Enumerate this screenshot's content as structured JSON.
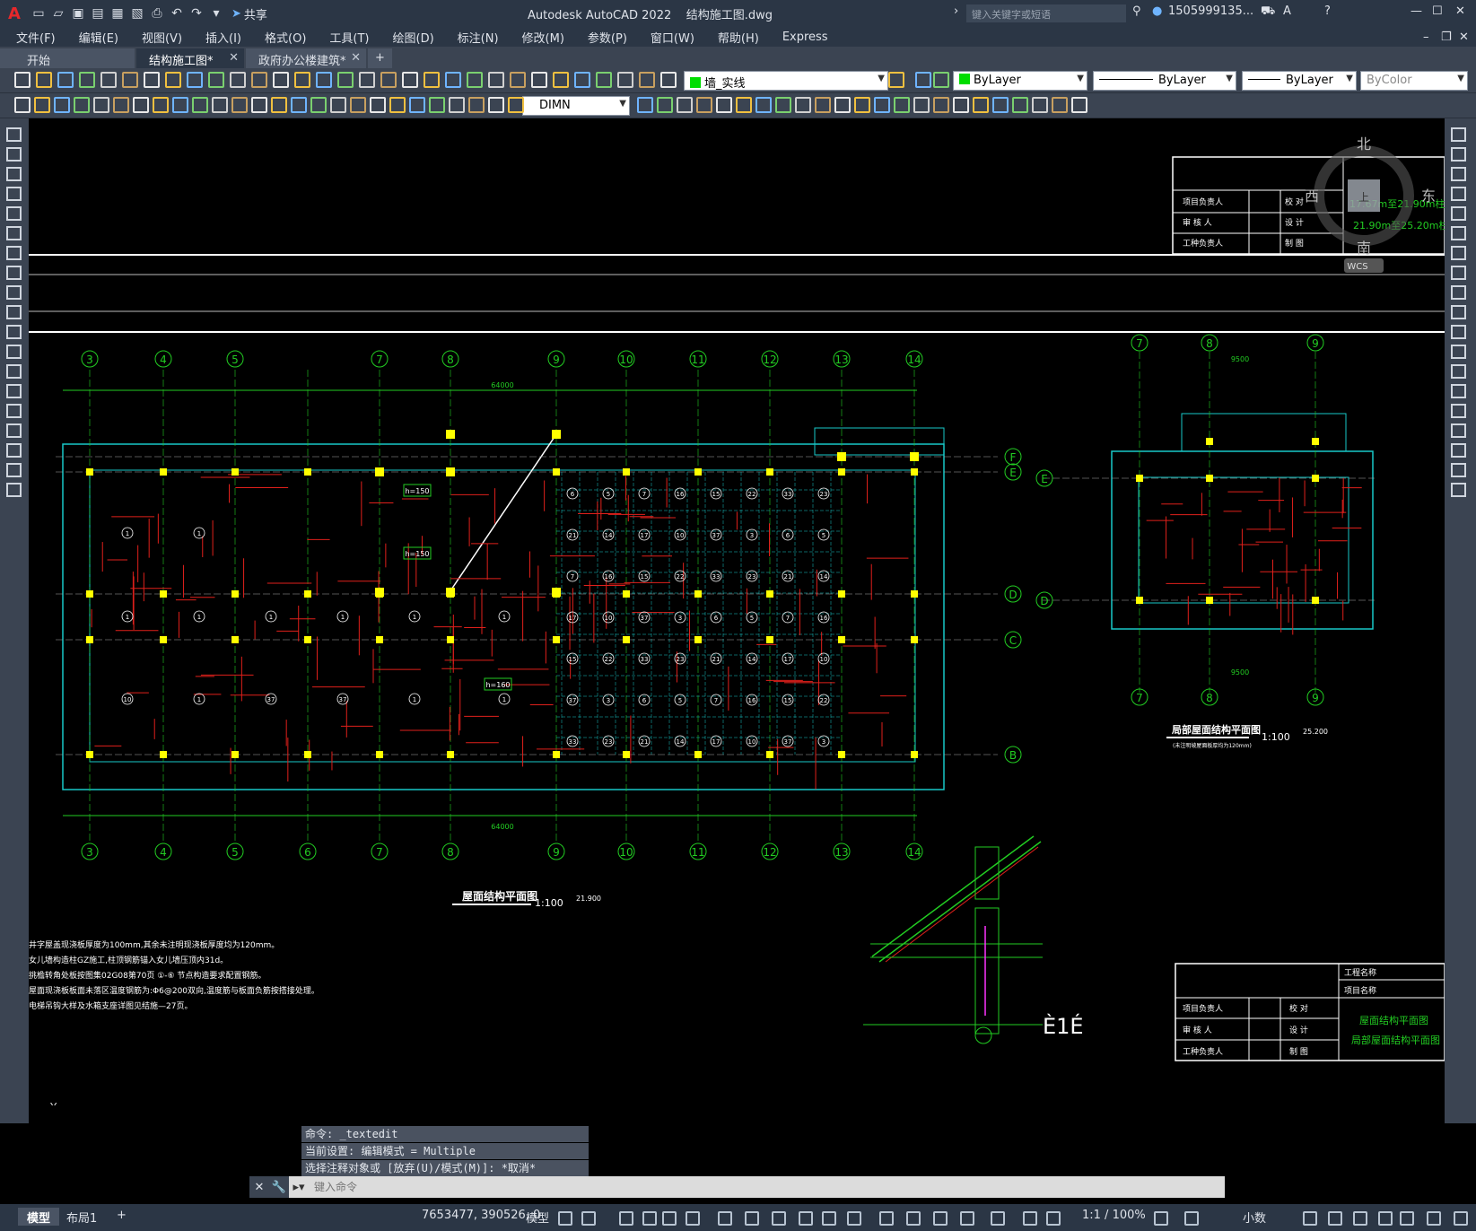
{
  "app": {
    "logo": "A",
    "title": "Autodesk AutoCAD 2022",
    "file": "结构施工图.dwg",
    "share_label": "共享",
    "search_placeholder": "键入关键字或短语",
    "user": "1505999135...",
    "help": "?"
  },
  "menu": [
    "文件(F)",
    "编辑(E)",
    "视图(V)",
    "插入(I)",
    "格式(O)",
    "工具(T)",
    "绘图(D)",
    "标注(N)",
    "修改(M)",
    "参数(P)",
    "窗口(W)",
    "帮助(H)",
    "Express"
  ],
  "tabs": [
    {
      "label": "开始"
    },
    {
      "label": "结构施工图*"
    },
    {
      "label": "政府办公楼建筑*"
    }
  ],
  "toolbar": {
    "layer": "墙_实线",
    "color": "ByLayer",
    "linetype": "ByLayer",
    "lineweight": "ByLayer",
    "plotstyle": "ByColor",
    "dimstyle": "DIMN"
  },
  "viewcube": {
    "north": "北",
    "south": "南",
    "east": "东",
    "west": "西",
    "top": "上",
    "wcs": "WCS"
  },
  "drawing": {
    "main_title": "屋面结构平面图",
    "main_scale": "1:100",
    "main_elev": "21.900",
    "local_title": "局部屋面结构平面图",
    "local_note": "(未注明坡屋面板厚均为120mm)",
    "local_scale": "1:100",
    "local_elev": "25.200",
    "overall_dim": "64000",
    "local_dim": "9500",
    "grid_top": [
      "3",
      "4",
      "5",
      "7",
      "8",
      "9",
      "10",
      "11",
      "12",
      "13",
      "14"
    ],
    "grid_bottom": [
      "3",
      "4",
      "5",
      "6",
      "7",
      "8",
      "9",
      "10",
      "11",
      "12",
      "13",
      "14"
    ],
    "grid_rows": [
      "F",
      "E",
      "D",
      "C",
      "B"
    ],
    "local_grid_cols": [
      "7",
      "8",
      "9"
    ],
    "local_grid_rows": [
      "E",
      "D"
    ],
    "notes": [
      "井字屋盖现浇板厚度为100mm,其余未注明现浇板厚度均为120mm。",
      "女儿墙构造柱GZ施工,柱顶钢筋锚入女儿墙压顶内31d。",
      "挑檐转角处板按图集02G08第70页 ①-⑥ 节点构造要求配置钢筋。",
      "屋面现浇板板面未落区温度钢筋为:Φ6@200双向,温度筋与板面负筋按搭接处理。",
      "电梯吊钩大样及水箱支座详图见结施—27页。"
    ],
    "section_label": "È1É",
    "title_block": {
      "project_manager": "项目负责人",
      "reviewer": "审 核 人",
      "engineer": "工种负责人",
      "check": "校 对",
      "design": "设 计",
      "draw": "制 图",
      "project_name": "工程名称",
      "item_name": "项目名称",
      "sheet_title_1": "屋面结构平面图",
      "sheet_title_2": "局部屋面结构平面图",
      "top_sheet_title_1": "17.67m至21.90m柱配筋",
      "top_sheet_title_2": "21.90m至25.20m柱配筋"
    },
    "h_labels": [
      "h=150",
      "h=150",
      "h=160"
    ]
  },
  "command": {
    "history": [
      "命令: _textedit",
      "当前设置: 编辑模式 = Multiple",
      "选择注释对象或 [放弃(U)/模式(M)]: *取消*"
    ],
    "placeholder": "键入命令"
  },
  "status": {
    "layout_tabs": [
      "模型",
      "布局1"
    ],
    "coords": "7653477, 390526, 0",
    "model": "模型",
    "annotation_scale": "1:1 / 100%",
    "units": "小数"
  },
  "colors": {
    "ui_dark": "#2b3645",
    "ui_mid": "#3b4452",
    "cad_green": "#22cc22",
    "cad_red": "#e0201b",
    "cad_cyan": "#18c8c8",
    "cad_yellow": "#ffff00",
    "cad_white": "#ffffff",
    "layer_swatch": "#00dd00"
  }
}
